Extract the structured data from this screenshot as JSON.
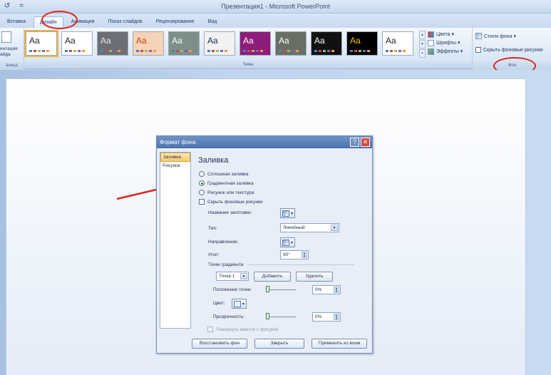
{
  "window": {
    "title": "Презентация1 - Microsoft PowerPoint"
  },
  "qat": {
    "undo_glyph": "↺",
    "more_glyph": "="
  },
  "tabs": [
    {
      "label": "Вставка"
    },
    {
      "label": "Дизайн",
      "active": true
    },
    {
      "label": "Анимация"
    },
    {
      "label": "Показ слайдов"
    },
    {
      "label": "Рецензирование"
    },
    {
      "label": "Вид"
    }
  ],
  "ribbon": {
    "left_group_label": "ентация\nайда",
    "left_group_caption": "аница",
    "themes_caption": "Темы",
    "theme_text": "Aa",
    "themes": [
      {
        "bg": "#ffffff",
        "fg": "#1d1d1d",
        "selected": true
      },
      {
        "bg": "#ffffff",
        "fg": "#1d1d1d"
      },
      {
        "bg": "#6c6f76",
        "fg": "#e8e8e8"
      },
      {
        "bg": "#f6d3b8",
        "fg": "#c1440e"
      },
      {
        "bg": "#7d8f8a",
        "fg": "#ffffff"
      },
      {
        "bg": "#f2f2f2",
        "fg": "#1b2a4a"
      },
      {
        "bg": "#8d1d7a",
        "fg": "#ffffff"
      },
      {
        "bg": "#6a6f64",
        "fg": "#ffffff"
      },
      {
        "bg": "#111111",
        "fg": "#ffffff"
      },
      {
        "bg": "#000000",
        "fg": "#f5c21b"
      },
      {
        "bg": "#ffffff",
        "fg": "#1d1d1d"
      }
    ],
    "theme_options": [
      {
        "label": "Цвета ▾",
        "icon": "colors-icon"
      },
      {
        "label": "Шрифты ▾",
        "icon": "fonts-icon"
      },
      {
        "label": "Эффекты ▾",
        "icon": "effects-icon"
      }
    ],
    "background": {
      "styles_label": "Стили фона ▾",
      "hide_label": "Скрыть фоновые рисунки",
      "caption": "Фон"
    }
  },
  "dialog": {
    "title": "Формат фона",
    "help_glyph": "?",
    "close_glyph": "✕",
    "side_items": [
      {
        "label": "Заливка",
        "selected": true
      },
      {
        "label": "Рисунок"
      }
    ],
    "heading": "Заливка",
    "fill_options": [
      {
        "label": "Сплошная заливка",
        "checked": false
      },
      {
        "label": "Градиентная заливка",
        "checked": true
      },
      {
        "label": "Рисунок или текстура",
        "checked": false
      }
    ],
    "hide_graphics_label": "Скрыть фоновые рисунки",
    "preset_label": "Название заготовки:",
    "type_label": "Тип:",
    "type_value": "Линейный",
    "direction_label": "Направление:",
    "angle_label": "Угол:",
    "angle_value": "90°",
    "stops_label": "Точки градиента",
    "stop_value": "Точка 1",
    "add_label": "Добавить",
    "remove_label": "Удалить",
    "stop_position_label": "Положение точки:",
    "stop_position_value": "0%",
    "stop_position_level": 0,
    "color_label": "Цвет:",
    "transparency_label": "Прозрачность:",
    "transparency_value": "0%",
    "transparency_level": 0,
    "rotate_label": "Повернуть вместе с фигурой",
    "reset_label": "Восстановить фон",
    "close_label": "Закрыть",
    "apply_all_label": "Применить ко всем"
  },
  "colors": {
    "annotation": "#d9261f",
    "selected_theme_border": "#f2b33d"
  }
}
